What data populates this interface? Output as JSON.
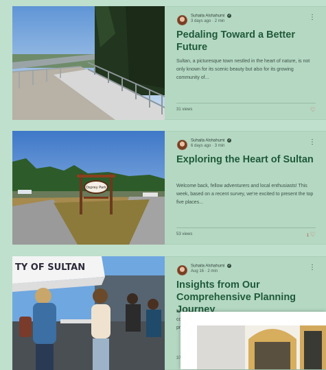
{
  "posts": [
    {
      "author": "Suhaila Alshahumi",
      "date": "3 days ago",
      "read_time": "2 min",
      "title": "Pedaling Toward a Better Future",
      "excerpt": "Sultan, a picturesque town nestled in the heart of nature, is not only known for its scenic beauty but also for its growing community of...",
      "views": "31 views",
      "likes": ""
    },
    {
      "author": "Suhaila Alshahumi",
      "date": "6 days ago",
      "read_time": "3 min",
      "title": "Exploring the Heart of Sultan",
      "excerpt": "Welcome back, fellow adventurers and local enthusiasts! This week, based on a recent survey, we're excited to present the top five places...",
      "views": "53 views",
      "likes": "1"
    },
    {
      "author": "Suhaila Alshahumi",
      "date": "Aug 16",
      "read_time": "2 min",
      "title": "Insights from Our Comprehensive Planning Journey",
      "excerpt_visible": "In\nco\npr",
      "views": "37",
      "likes": ""
    }
  ],
  "sign_text": "Osprey Park",
  "banner_text": "TY OF SULTAN",
  "icons": {
    "menu": "kebab-menu-icon",
    "heart": "heart-icon",
    "verified": "verified-badge-icon"
  },
  "colors": {
    "page_bg": "#bfe0cc",
    "card_bg": "#b4d8c2",
    "title": "#1f5a3a",
    "heart": "#d9534f"
  }
}
